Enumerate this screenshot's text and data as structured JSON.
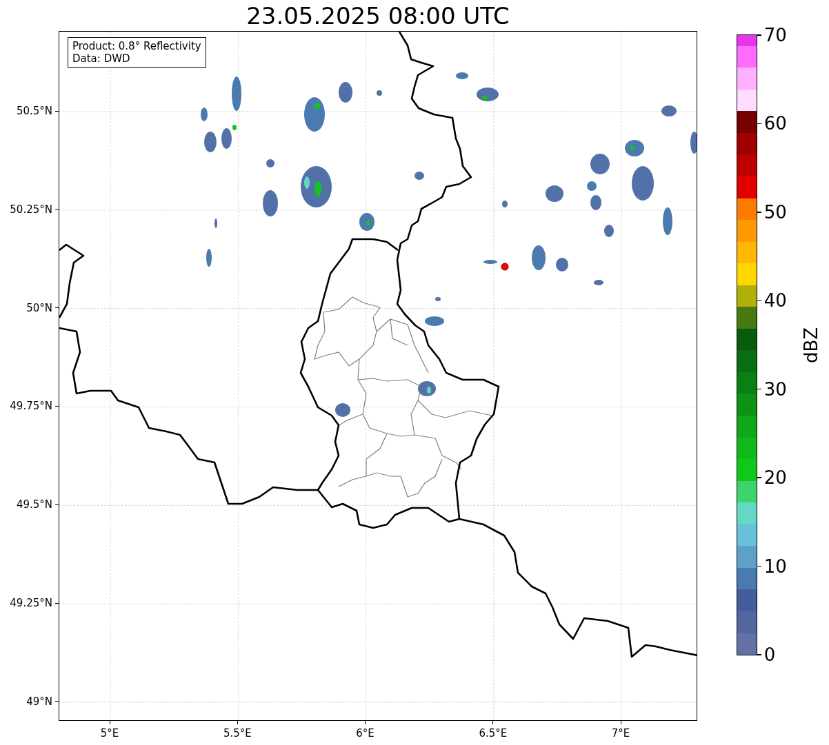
{
  "title": "23.05.2025 08:00 UTC",
  "info_box": [
    "Product: 0.8° Reflectivity",
    "Data: DWD"
  ],
  "y_ticks": [
    "50.5°N",
    "50.25°N",
    "50°N",
    "49.75°N",
    "49.5°N",
    "49.25°N",
    "49°N"
  ],
  "x_ticks": [
    "5°E",
    "5.5°E",
    "6°E",
    "6.5°E",
    "7°E"
  ],
  "colorbar": {
    "label": "dBZ",
    "ticks": [
      "70",
      "60",
      "50",
      "40",
      "30",
      "20",
      "10",
      "0"
    ],
    "segments": [
      {
        "color": "#e935e9"
      },
      {
        "color": "#ff6bff"
      },
      {
        "color": "#ffb0ff"
      },
      {
        "color": "#ffddff"
      },
      {
        "color": "#780000"
      },
      {
        "color": "#a00000"
      },
      {
        "color": "#c00000"
      },
      {
        "color": "#e00000"
      },
      {
        "color": "#ff7c00"
      },
      {
        "color": "#ff9a00"
      },
      {
        "color": "#ffb700"
      },
      {
        "color": "#ffd700"
      },
      {
        "color": "#b0b008"
      },
      {
        "color": "#47790f"
      },
      {
        "color": "#085c0e"
      },
      {
        "color": "#0a6e12"
      },
      {
        "color": "#0a7f12"
      },
      {
        "color": "#0c9215"
      },
      {
        "color": "#0fa818"
      },
      {
        "color": "#0fba1a"
      },
      {
        "color": "#10c81a"
      },
      {
        "color": "#3dd470"
      },
      {
        "color": "#63d8c5"
      },
      {
        "color": "#68c1da"
      },
      {
        "color": "#5ea0c8"
      },
      {
        "color": "#4a7ab0"
      },
      {
        "color": "#435d9f"
      },
      {
        "color": "#53669e"
      },
      {
        "color": "#6272a6"
      }
    ]
  }
}
